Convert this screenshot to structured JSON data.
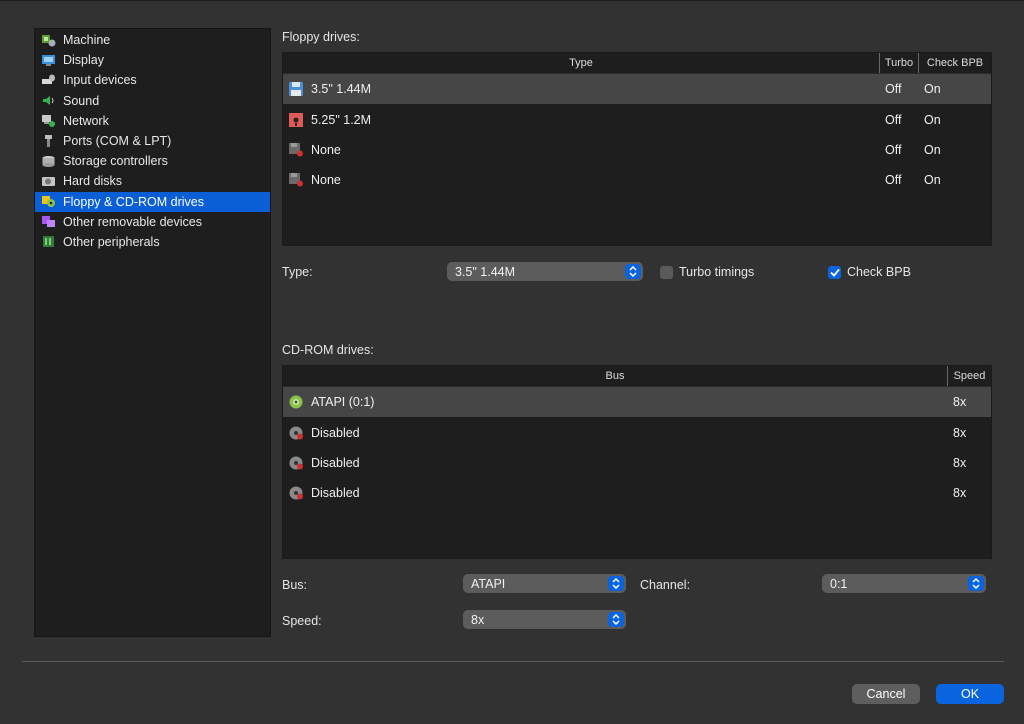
{
  "sidebar": {
    "items": [
      {
        "label": "Machine",
        "icon": "machine-icon"
      },
      {
        "label": "Display",
        "icon": "display-icon"
      },
      {
        "label": "Input devices",
        "icon": "input-devices-icon"
      },
      {
        "label": "Sound",
        "icon": "sound-icon"
      },
      {
        "label": "Network",
        "icon": "network-icon"
      },
      {
        "label": "Ports (COM & LPT)",
        "icon": "ports-icon"
      },
      {
        "label": "Storage controllers",
        "icon": "storage-controllers-icon"
      },
      {
        "label": "Hard disks",
        "icon": "hard-disk-icon"
      },
      {
        "label": "Floppy & CD-ROM drives",
        "icon": "floppy-cdrom-icon",
        "selected": true
      },
      {
        "label": "Other removable devices",
        "icon": "removable-devices-icon"
      },
      {
        "label": "Other peripherals",
        "icon": "peripherals-icon"
      }
    ]
  },
  "floppy": {
    "title": "Floppy drives:",
    "headers": {
      "type": "Type",
      "turbo": "Turbo",
      "check_bpb": "Check BPB"
    },
    "rows": [
      {
        "type": "3.5\" 1.44M",
        "turbo": "Off",
        "check_bpb": "On",
        "icon": "floppy-35-icon",
        "selected": true
      },
      {
        "type": "5.25\" 1.2M",
        "turbo": "Off",
        "check_bpb": "On",
        "icon": "floppy-525-icon"
      },
      {
        "type": "None",
        "turbo": "Off",
        "check_bpb": "On",
        "icon": "floppy-disabled-icon"
      },
      {
        "type": "None",
        "turbo": "Off",
        "check_bpb": "On",
        "icon": "floppy-disabled-icon"
      }
    ],
    "type_label": "Type:",
    "type_value": "3.5\" 1.44M",
    "turbo_label": "Turbo timings",
    "turbo_checked": false,
    "check_bpb_label": "Check BPB",
    "check_bpb_checked": true
  },
  "cdrom": {
    "title": "CD-ROM drives:",
    "headers": {
      "bus": "Bus",
      "speed": "Speed"
    },
    "rows": [
      {
        "bus": "ATAPI (0:1)",
        "speed": "8x",
        "icon": "cdrom-icon",
        "selected": true
      },
      {
        "bus": "Disabled",
        "speed": "8x",
        "icon": "cdrom-disabled-icon"
      },
      {
        "bus": "Disabled",
        "speed": "8x",
        "icon": "cdrom-disabled-icon"
      },
      {
        "bus": "Disabled",
        "speed": "8x",
        "icon": "cdrom-disabled-icon"
      }
    ],
    "bus_label": "Bus:",
    "bus_value": "ATAPI",
    "channel_label": "Channel:",
    "channel_value": "0:1",
    "speed_label": "Speed:",
    "speed_value": "8x"
  },
  "buttons": {
    "cancel": "Cancel",
    "ok": "OK"
  },
  "colors": {
    "accent": "#0a64e0",
    "selection": "#0a5fd6",
    "panel": "#1e1e1e",
    "background": "#323232"
  }
}
